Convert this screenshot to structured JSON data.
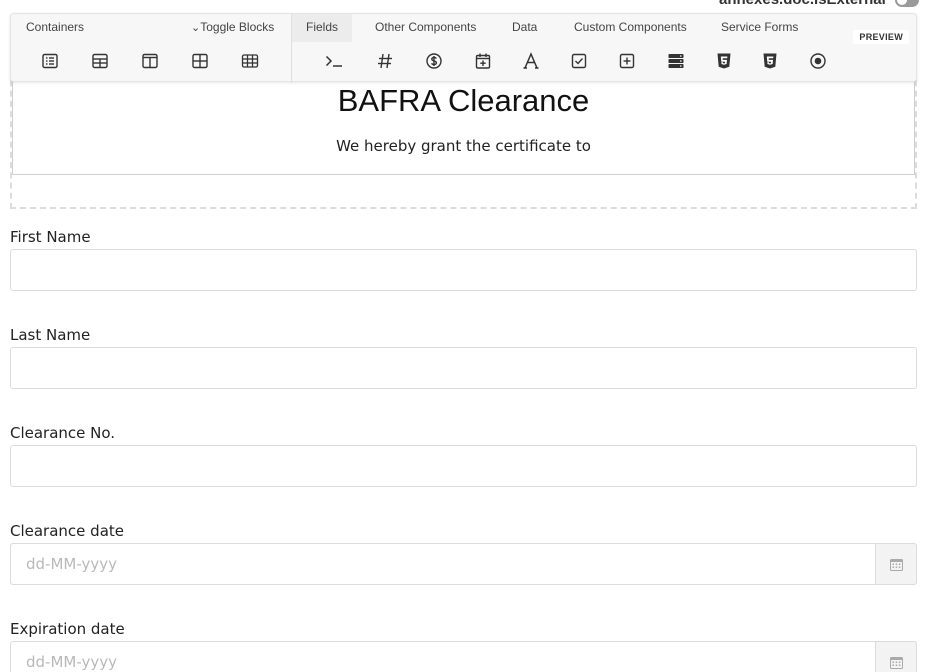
{
  "top": {
    "clipped_label": "annexes.doc.isExternal"
  },
  "toolbar": {
    "containers_label": "Containers",
    "toggle_blocks_label": "Toggle Blocks",
    "tabs": [
      {
        "label": "Fields",
        "active": true
      },
      {
        "label": "Other Components",
        "active": false
      },
      {
        "label": "Data",
        "active": false
      },
      {
        "label": "Custom Components",
        "active": false
      },
      {
        "label": "Service Forms",
        "active": false
      }
    ],
    "preview_label": "PREVIEW",
    "container_icons": [
      "list-icon",
      "table-grid-icon",
      "columns-icon",
      "panel-grid-icon",
      "datagrid-icon"
    ],
    "field_icons": [
      "terminal-icon",
      "number-hash-icon",
      "currency-icon",
      "calendar-plus-icon",
      "text-font-icon",
      "checkbox-icon",
      "add-box-icon",
      "server-icon",
      "html5-icon",
      "html5-alt-icon",
      "radio-icon"
    ]
  },
  "header": {
    "title": "BAFRA Clearance",
    "subtitle": "We hereby grant the certificate to"
  },
  "form": {
    "first_name_label": "First Name",
    "last_name_label": "Last Name",
    "clearance_no_label": "Clearance No.",
    "clearance_date_label": "Clearance date",
    "clearance_date_placeholder": "dd-MM-yyyy",
    "expiration_date_label": "Expiration date",
    "expiration_date_placeholder": "dd-MM-yyyy"
  }
}
